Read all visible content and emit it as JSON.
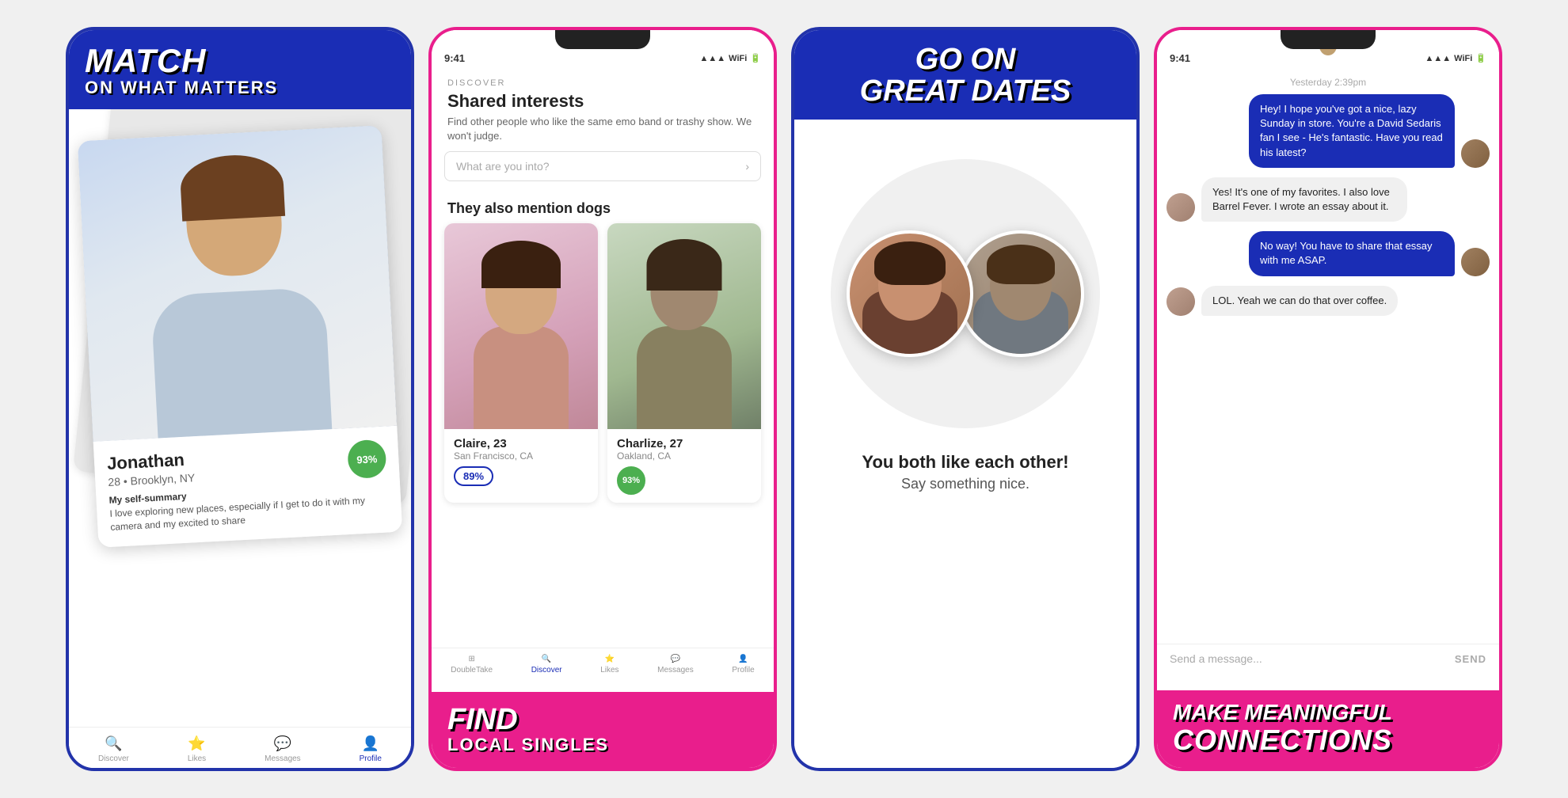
{
  "panel1": {
    "header_title": "MATCH",
    "header_subtitle": "ON WHAT MATTERS",
    "profile": {
      "name": "Jonathan",
      "age": "28",
      "location": "Brooklyn, NY",
      "match_pct": "93%",
      "summary_label": "My self-summary",
      "summary_text": "I love exploring new places, especially if I get to do it with my camera and my excited to share"
    },
    "nav_items": [
      {
        "label": "Discover",
        "icon": "🔍",
        "active": false
      },
      {
        "label": "Likes",
        "icon": "⭐",
        "active": false
      },
      {
        "label": "Messages",
        "icon": "💬",
        "active": false
      },
      {
        "label": "Profile",
        "icon": "👤",
        "active": true
      }
    ]
  },
  "panel2": {
    "status_time": "9:41",
    "discover_label": "DISCOVER",
    "discover_title": "Shared interests",
    "discover_desc": "Find other people who like the same emo band or trashy show. We won't judge.",
    "search_placeholder": "What are you into?",
    "section_title": "They also mention dogs",
    "profiles": [
      {
        "name": "Claire, 23",
        "location": "San Francisco, CA",
        "match_pct": "89%",
        "match_style": "blue"
      },
      {
        "name": "Charlize, 27",
        "location": "Oakland, CA",
        "match_pct": "93%",
        "match_style": "green"
      }
    ],
    "footer_title": "FIND",
    "footer_subtitle": "LOCAL SINGLES",
    "nav_items": [
      {
        "label": "DoubleTake",
        "icon": "⊞",
        "active": false
      },
      {
        "label": "Discover",
        "icon": "🔍",
        "active": true
      },
      {
        "label": "Likes",
        "icon": "⭐",
        "active": false
      },
      {
        "label": "Messages",
        "icon": "💬",
        "active": false
      },
      {
        "label": "Profile",
        "icon": "👤",
        "active": false
      }
    ]
  },
  "panel3": {
    "header_line1": "GO ON",
    "header_line2": "GREAT DATES",
    "match_text": "You both like each other!",
    "match_subtext": "Say something nice."
  },
  "panel4": {
    "status_time": "9:41",
    "timestamp": "Yesterday 2:39pm",
    "messages": [
      {
        "type": "sent",
        "text": "Hey! I hope you've got a nice, lazy Sunday in store. You're a David Sedaris fan I see - He's fantastic. Have you read his latest?",
        "avatar": "male"
      },
      {
        "type": "received",
        "text": "Yes! It's one of my favorites. I also love Barrel Fever. I wrote an essay about it.",
        "avatar": "female"
      },
      {
        "type": "sent",
        "text": "No way! You have to share that essay with me ASAP.",
        "avatar": "male"
      },
      {
        "type": "received",
        "text": "LOL. Yeah we can do that over coffee.",
        "avatar": "female"
      }
    ],
    "input_placeholder": "Send a message...",
    "send_label": "SEND",
    "footer_title": "MAKE MEANINGFUL",
    "footer_subtitle": "CONNECTIONS"
  }
}
